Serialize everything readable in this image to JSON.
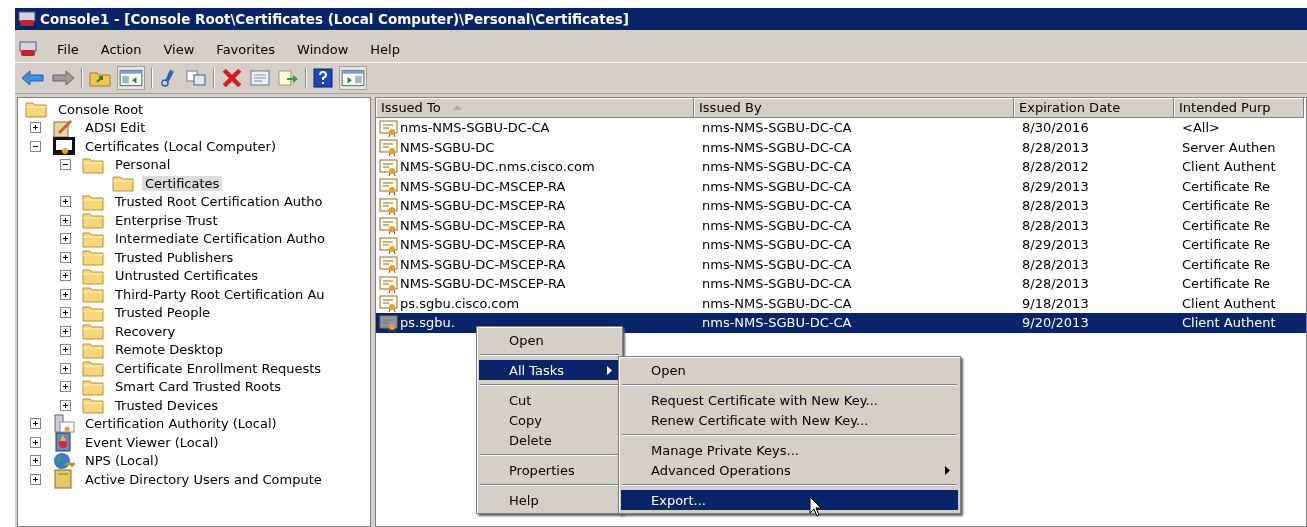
{
  "window": {
    "title": "Console1 - [Console Root\\Certificates (Local Computer)\\Personal\\Certificates]"
  },
  "menu_bar": [
    "File",
    "Action",
    "View",
    "Favorites",
    "Window",
    "Help"
  ],
  "tree": [
    {
      "label": "Console Root",
      "kind": "folder",
      "selected": false,
      "children": [
        {
          "label": "ADSI Edit",
          "kind": "adsi",
          "expanded": false,
          "selected": false
        },
        {
          "label": "Certificates (Local Computer)",
          "kind": "certstore",
          "expanded": true,
          "selected": false,
          "children": [
            {
              "label": "Personal",
              "kind": "folder",
              "expanded": true,
              "selected": false,
              "children": [
                {
                  "label": "Certificates",
                  "kind": "folder",
                  "selected": true
                }
              ]
            },
            {
              "label": "Trusted Root Certification Autho",
              "kind": "folder",
              "expanded": false,
              "selected": false
            },
            {
              "label": "Enterprise Trust",
              "kind": "folder",
              "expanded": false,
              "selected": false
            },
            {
              "label": "Intermediate Certification Autho",
              "kind": "folder",
              "expanded": false,
              "selected": false
            },
            {
              "label": "Trusted Publishers",
              "kind": "folder",
              "expanded": false,
              "selected": false
            },
            {
              "label": "Untrusted Certificates",
              "kind": "folder",
              "expanded": false,
              "selected": false
            },
            {
              "label": "Third-Party Root Certification Au",
              "kind": "folder",
              "expanded": false,
              "selected": false
            },
            {
              "label": "Trusted People",
              "kind": "folder",
              "expanded": false,
              "selected": false
            },
            {
              "label": "Recovery",
              "kind": "folder",
              "expanded": false,
              "selected": false
            },
            {
              "label": "Remote Desktop",
              "kind": "folder",
              "expanded": false,
              "selected": false
            },
            {
              "label": "Certificate Enrollment Requests",
              "kind": "folder",
              "expanded": false,
              "selected": false
            },
            {
              "label": "Smart Card Trusted Roots",
              "kind": "folder",
              "expanded": false,
              "selected": false
            },
            {
              "label": "Trusted Devices",
              "kind": "folder",
              "expanded": false,
              "selected": false
            }
          ]
        },
        {
          "label": "Certification Authority (Local)",
          "kind": "ca",
          "expanded": false,
          "selected": false
        },
        {
          "label": "Event Viewer (Local)",
          "kind": "event",
          "expanded": false,
          "selected": false
        },
        {
          "label": "NPS (Local)",
          "kind": "globe",
          "expanded": false,
          "selected": false
        },
        {
          "label": "Active Directory Users and Compute",
          "kind": "book",
          "expanded": false,
          "selected": false
        }
      ]
    }
  ],
  "table": {
    "columns": [
      {
        "label": "Issued To",
        "sorted": true
      },
      {
        "label": "Issued By",
        "sorted": false
      },
      {
        "label": "Expiration Date",
        "sorted": false
      },
      {
        "label": "Intended Purp",
        "sorted": false
      }
    ],
    "rows": [
      {
        "issued_to": "nms-NMS-SGBU-DC-CA",
        "issued_by": "nms-NMS-SGBU-DC-CA",
        "expiration_date": "8/30/2016",
        "intended_purpose": "<All>",
        "selected": false
      },
      {
        "issued_to": "NMS-SGBU-DC",
        "issued_by": "nms-NMS-SGBU-DC-CA",
        "expiration_date": "8/28/2013",
        "intended_purpose": "Server Authen",
        "selected": false
      },
      {
        "issued_to": "NMS-SGBU-DC.nms.cisco.com",
        "issued_by": "nms-NMS-SGBU-DC-CA",
        "expiration_date": "8/28/2012",
        "intended_purpose": "Client Authent",
        "selected": false
      },
      {
        "issued_to": "NMS-SGBU-DC-MSCEP-RA",
        "issued_by": "nms-NMS-SGBU-DC-CA",
        "expiration_date": "8/29/2013",
        "intended_purpose": "Certificate Re",
        "selected": false
      },
      {
        "issued_to": "NMS-SGBU-DC-MSCEP-RA",
        "issued_by": "nms-NMS-SGBU-DC-CA",
        "expiration_date": "8/28/2013",
        "intended_purpose": "Certificate Re",
        "selected": false
      },
      {
        "issued_to": "NMS-SGBU-DC-MSCEP-RA",
        "issued_by": "nms-NMS-SGBU-DC-CA",
        "expiration_date": "8/28/2013",
        "intended_purpose": "Certificate Re",
        "selected": false
      },
      {
        "issued_to": "NMS-SGBU-DC-MSCEP-RA",
        "issued_by": "nms-NMS-SGBU-DC-CA",
        "expiration_date": "8/29/2013",
        "intended_purpose": "Certificate Re",
        "selected": false
      },
      {
        "issued_to": "NMS-SGBU-DC-MSCEP-RA",
        "issued_by": "nms-NMS-SGBU-DC-CA",
        "expiration_date": "8/28/2013",
        "intended_purpose": "Certificate Re",
        "selected": false
      },
      {
        "issued_to": "NMS-SGBU-DC-MSCEP-RA",
        "issued_by": "nms-NMS-SGBU-DC-CA",
        "expiration_date": "8/28/2013",
        "intended_purpose": "Certificate Re",
        "selected": false
      },
      {
        "issued_to": "ps.sgbu.cisco.com",
        "issued_by": "nms-NMS-SGBU-DC-CA",
        "expiration_date": "9/18/2013",
        "intended_purpose": "Client Authent",
        "selected": false
      },
      {
        "issued_to": "ps.sgbu.",
        "issued_by": "nms-NMS-SGBU-DC-CA",
        "expiration_date": "9/20/2013",
        "intended_purpose": "Client Authent",
        "selected": true
      }
    ]
  },
  "context_menu": {
    "items": [
      {
        "kind": "item",
        "label": "Open",
        "highlighted": false,
        "submenu": false
      },
      {
        "kind": "separator"
      },
      {
        "kind": "item",
        "label": "All Tasks",
        "highlighted": true,
        "submenu": true
      },
      {
        "kind": "separator"
      },
      {
        "kind": "item",
        "label": "Cut",
        "highlighted": false,
        "submenu": false
      },
      {
        "kind": "item",
        "label": "Copy",
        "highlighted": false,
        "submenu": false
      },
      {
        "kind": "item",
        "label": "Delete",
        "highlighted": false,
        "submenu": false
      },
      {
        "kind": "separator"
      },
      {
        "kind": "item",
        "label": "Properties",
        "highlighted": false,
        "submenu": false
      },
      {
        "kind": "separator"
      },
      {
        "kind": "item",
        "label": "Help",
        "highlighted": false,
        "submenu": false
      }
    ]
  },
  "submenu": {
    "items": [
      {
        "kind": "item",
        "label": "Open",
        "highlighted": false,
        "submenu": false
      },
      {
        "kind": "separator"
      },
      {
        "kind": "item",
        "label": "Request Certificate with New Key...",
        "highlighted": false,
        "submenu": false
      },
      {
        "kind": "item",
        "label": "Renew Certificate with New Key...",
        "highlighted": false,
        "submenu": false
      },
      {
        "kind": "separator"
      },
      {
        "kind": "item",
        "label": "Manage Private Keys...",
        "highlighted": false,
        "submenu": false
      },
      {
        "kind": "item",
        "label": "Advanced Operations",
        "highlighted": false,
        "submenu": true
      },
      {
        "kind": "separator"
      },
      {
        "kind": "item",
        "label": "Export...",
        "highlighted": true,
        "submenu": false
      }
    ]
  }
}
